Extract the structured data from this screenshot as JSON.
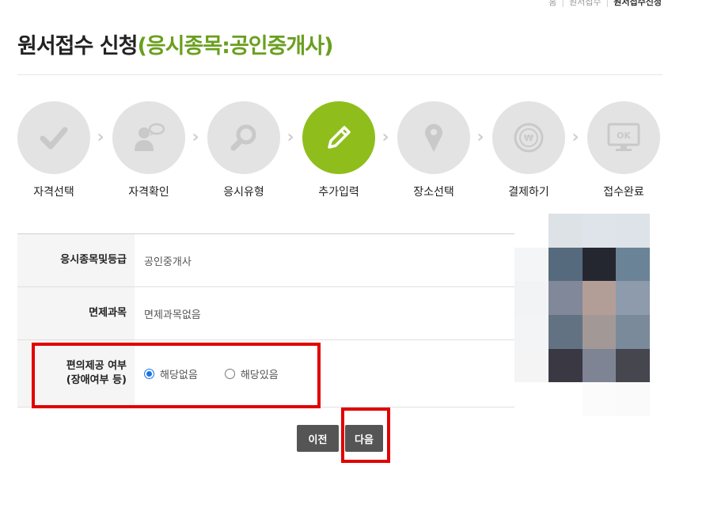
{
  "breadcrumb": {
    "home": "홈",
    "section": "원서접수",
    "current": "원서접수신청"
  },
  "page": {
    "title_main": "원서접수 신청",
    "title_sub": "(응시종목:공인중개사)"
  },
  "steps": [
    {
      "label": "자격선택",
      "icon": "check-icon",
      "active": false
    },
    {
      "label": "자격확인",
      "icon": "person-chat-icon",
      "active": false
    },
    {
      "label": "응시유형",
      "icon": "magnifier-icon",
      "active": false
    },
    {
      "label": "추가입력",
      "icon": "pencil-icon",
      "active": true
    },
    {
      "label": "장소선택",
      "icon": "location-pin-icon",
      "active": false
    },
    {
      "label": "결제하기",
      "icon": "won-coin-icon",
      "active": false
    },
    {
      "label": "접수완료",
      "icon": "ok-monitor-icon",
      "active": false
    }
  ],
  "form": {
    "exam_label": "응시종목및등급",
    "exam_value": "공인중개사",
    "exempt_label": "면제과목",
    "exempt_value": "면제과목없음",
    "accessibility_label_1": "편의제공 여부",
    "accessibility_label_2": "(장애여부 등)",
    "option_none": "해당없음",
    "option_yes": "해당있음",
    "selected": "해당없음"
  },
  "buttons": {
    "prev": "이전",
    "next": "다음"
  },
  "colors": {
    "accent": "#8fbe1c",
    "title_sub": "#6a9f1e",
    "highlight": "#e10000",
    "button": "#555555"
  }
}
